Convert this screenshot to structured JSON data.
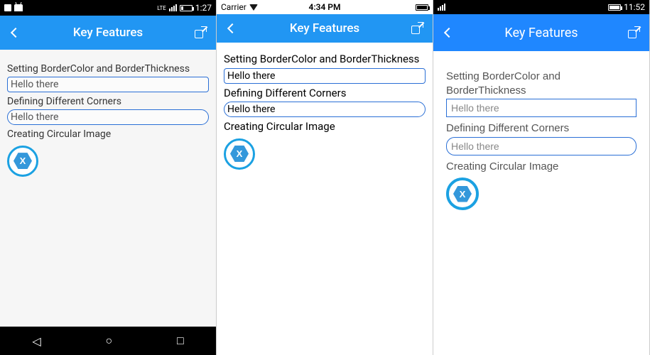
{
  "common": {
    "title": "Key Features",
    "label_border": "Setting BorderColor and BorderThickness",
    "label_corners": "Defining Different Corners",
    "label_circle": "Creating Circular Image",
    "box_text": "Hello there"
  },
  "android": {
    "status_time": "1:27",
    "status_lte": "LTE"
  },
  "ios": {
    "status_time": "4:34 PM",
    "carrier": "Carrier"
  },
  "wp": {
    "status_time": "11:52"
  }
}
